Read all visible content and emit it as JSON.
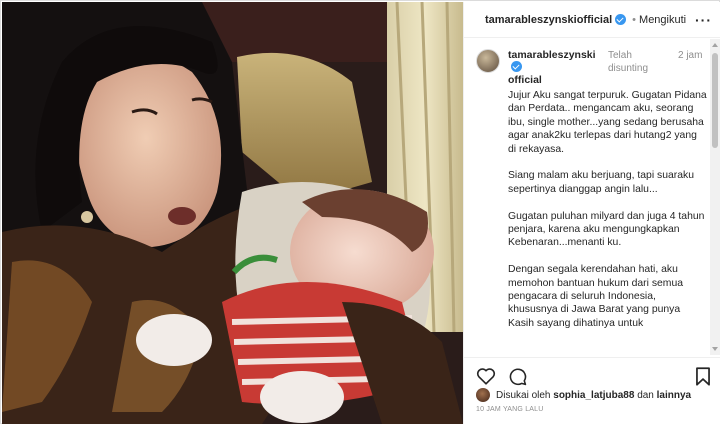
{
  "header": {
    "username": "tamarableszynskiofficial",
    "separator": "•",
    "follow_label": "Mengikuti",
    "more_label": "···"
  },
  "caption": {
    "username_line1": "tamarableszynski",
    "username_line2": "official",
    "edited_label": "Telah disunting",
    "time_label": "2 jam",
    "paragraphs": [
      "Jujur Aku sangat terpuruk. Gugatan Pidana dan Perdata.. mengancam aku, seorang ibu, single mother...yang sedang berusaha agar anak2ku terlepas dari hutang2 yang di rekayasa.",
      "Siang malam aku berjuang, tapi suaraku sepertinya dianggap angin lalu...",
      "Gugatan puluhan milyard dan juga 4 tahun penjara, karena aku mengungkapkan Kebenaran...menanti ku.",
      "Dengan segala kerendahan hati, aku memohon bantuan hukum dari semua pengacara di seluruh Indonesia, khususnya di Jawa Barat yang punya Kasih sayang dihatinya untuk"
    ]
  },
  "likes": {
    "prefix": "Disukai oleh",
    "user": "sophia_latjuba88",
    "conjunction": "dan",
    "others": "lainnya"
  },
  "posted_ago": "10 JAM YANG LALU",
  "icons": {
    "like": "heart-icon",
    "comment": "comment-icon",
    "save": "bookmark-icon",
    "verified": "verified-badge-icon"
  },
  "colors": {
    "verified_blue": "#3897f0",
    "secondary_text": "#8e8e8e",
    "border": "#dbdbdb"
  }
}
